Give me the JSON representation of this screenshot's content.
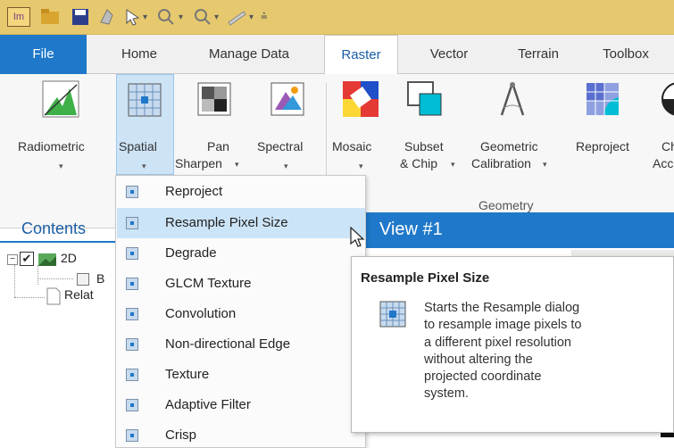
{
  "app": {
    "logo_text": "Im"
  },
  "tabs": [
    {
      "label": "File"
    },
    {
      "label": "Home"
    },
    {
      "label": "Manage Data"
    },
    {
      "label": "Raster"
    },
    {
      "label": "Vector"
    },
    {
      "label": "Terrain"
    },
    {
      "label": "Toolbox"
    }
  ],
  "ribbon": {
    "radiometric": "Radiometric",
    "spatial": "Spatial",
    "pan_line1": "Pan",
    "pan_line2": "Sharpen",
    "spectral": "Spectral",
    "mosaic": "Mosaic",
    "subset_line1": "Subset",
    "subset_line2": "& Chip",
    "geometric_line1": "Geometric",
    "geometric_line2": "Calibration",
    "reproject": "Reproject",
    "cut_line1": "Ch",
    "cut_line2": "Acc",
    "group_geometry": "Geometry"
  },
  "contents": {
    "title": "Contents",
    "tree": [
      "2D",
      "B",
      "Relat"
    ]
  },
  "view": {
    "title": "View #1"
  },
  "menu": {
    "items": [
      "Reproject",
      "Resample Pixel Size",
      "Degrade",
      "GLCM Texture",
      "Convolution",
      "Non-directional Edge",
      "Texture",
      "Adaptive Filter",
      "Crisp"
    ],
    "highlighted": "Resample Pixel Size"
  },
  "tooltip": {
    "title": "Resample Pixel Size",
    "lines": [
      "Starts the Resample dialog",
      "to resample image pixels to",
      "a different pixel resolution",
      "without altering the",
      "projected coordinate",
      "system."
    ]
  },
  "colors": {
    "accent": "#1f78c9",
    "qat": "#e6c96e",
    "highlight": "#cce4f7"
  }
}
